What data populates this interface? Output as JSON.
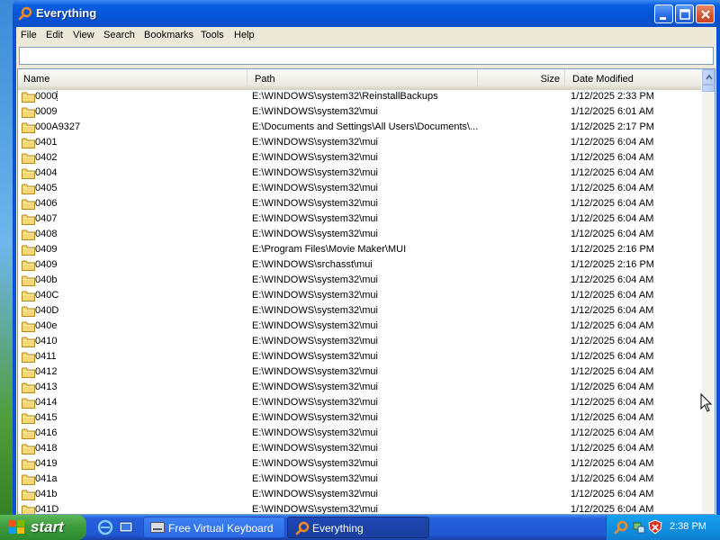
{
  "window": {
    "title": "Everything",
    "buttons": {
      "minimize": "minimize",
      "maximize": "maximize",
      "close": "close"
    }
  },
  "menu": [
    "File",
    "Edit",
    "View",
    "Search",
    "Bookmarks",
    "Tools",
    "Help"
  ],
  "search": {
    "value": "",
    "placeholder": ""
  },
  "columns": {
    "name": "Name",
    "path": "Path",
    "size": "Size",
    "date": "Date Modified"
  },
  "rows": [
    {
      "name": "0000",
      "path": "E:\\WINDOWS\\system32\\ReinstallBackups",
      "size": "",
      "date": "1/12/2025 2:33 PM"
    },
    {
      "name": "0009",
      "path": "E:\\WINDOWS\\system32\\mui",
      "size": "",
      "date": "1/12/2025 6:01 AM"
    },
    {
      "name": "000A9327",
      "path": "E:\\Documents and Settings\\All Users\\Documents\\...",
      "size": "",
      "date": "1/12/2025 2:17 PM"
    },
    {
      "name": "0401",
      "path": "E:\\WINDOWS\\system32\\mui",
      "size": "",
      "date": "1/12/2025 6:04 AM"
    },
    {
      "name": "0402",
      "path": "E:\\WINDOWS\\system32\\mui",
      "size": "",
      "date": "1/12/2025 6:04 AM"
    },
    {
      "name": "0404",
      "path": "E:\\WINDOWS\\system32\\mui",
      "size": "",
      "date": "1/12/2025 6:04 AM"
    },
    {
      "name": "0405",
      "path": "E:\\WINDOWS\\system32\\mui",
      "size": "",
      "date": "1/12/2025 6:04 AM"
    },
    {
      "name": "0406",
      "path": "E:\\WINDOWS\\system32\\mui",
      "size": "",
      "date": "1/12/2025 6:04 AM"
    },
    {
      "name": "0407",
      "path": "E:\\WINDOWS\\system32\\mui",
      "size": "",
      "date": "1/12/2025 6:04 AM"
    },
    {
      "name": "0408",
      "path": "E:\\WINDOWS\\system32\\mui",
      "size": "",
      "date": "1/12/2025 6:04 AM"
    },
    {
      "name": "0409",
      "path": "E:\\Program Files\\Movie Maker\\MUI",
      "size": "",
      "date": "1/12/2025 2:16 PM"
    },
    {
      "name": "0409",
      "path": "E:\\WINDOWS\\srchasst\\mui",
      "size": "",
      "date": "1/12/2025 2:16 PM"
    },
    {
      "name": "040b",
      "path": "E:\\WINDOWS\\system32\\mui",
      "size": "",
      "date": "1/12/2025 6:04 AM"
    },
    {
      "name": "040C",
      "path": "E:\\WINDOWS\\system32\\mui",
      "size": "",
      "date": "1/12/2025 6:04 AM"
    },
    {
      "name": "040D",
      "path": "E:\\WINDOWS\\system32\\mui",
      "size": "",
      "date": "1/12/2025 6:04 AM"
    },
    {
      "name": "040e",
      "path": "E:\\WINDOWS\\system32\\mui",
      "size": "",
      "date": "1/12/2025 6:04 AM"
    },
    {
      "name": "0410",
      "path": "E:\\WINDOWS\\system32\\mui",
      "size": "",
      "date": "1/12/2025 6:04 AM"
    },
    {
      "name": "0411",
      "path": "E:\\WINDOWS\\system32\\mui",
      "size": "",
      "date": "1/12/2025 6:04 AM"
    },
    {
      "name": "0412",
      "path": "E:\\WINDOWS\\system32\\mui",
      "size": "",
      "date": "1/12/2025 6:04 AM"
    },
    {
      "name": "0413",
      "path": "E:\\WINDOWS\\system32\\mui",
      "size": "",
      "date": "1/12/2025 6:04 AM"
    },
    {
      "name": "0414",
      "path": "E:\\WINDOWS\\system32\\mui",
      "size": "",
      "date": "1/12/2025 6:04 AM"
    },
    {
      "name": "0415",
      "path": "E:\\WINDOWS\\system32\\mui",
      "size": "",
      "date": "1/12/2025 6:04 AM"
    },
    {
      "name": "0416",
      "path": "E:\\WINDOWS\\system32\\mui",
      "size": "",
      "date": "1/12/2025 6:04 AM"
    },
    {
      "name": "0418",
      "path": "E:\\WINDOWS\\system32\\mui",
      "size": "",
      "date": "1/12/2025 6:04 AM"
    },
    {
      "name": "0419",
      "path": "E:\\WINDOWS\\system32\\mui",
      "size": "",
      "date": "1/12/2025 6:04 AM"
    },
    {
      "name": "041a",
      "path": "E:\\WINDOWS\\system32\\mui",
      "size": "",
      "date": "1/12/2025 6:04 AM"
    },
    {
      "name": "041b",
      "path": "E:\\WINDOWS\\system32\\mui",
      "size": "",
      "date": "1/12/2025 6:04 AM"
    },
    {
      "name": "041D",
      "path": "E:\\WINDOWS\\system32\\mui",
      "size": "",
      "date": "1/12/2025 6:04 AM"
    }
  ],
  "taskbar": {
    "start_label": "start",
    "tasks": [
      {
        "label": "Free Virtual Keyboard",
        "icon": "keyboard-icon",
        "active": false
      },
      {
        "label": "Everything",
        "icon": "everything-icon",
        "active": true
      }
    ],
    "quicklaunch": [
      "internet-explorer-icon",
      "show-desktop-icon"
    ],
    "tray_icons": [
      "everything-tray-icon",
      "network-icon",
      "security-alert-icon"
    ],
    "clock": "2:38 PM"
  },
  "colors": {
    "title_bar": "#0654d6",
    "taskbar": "#245edb",
    "start_button": "#3c9a3b",
    "folder": "#f5d774"
  }
}
